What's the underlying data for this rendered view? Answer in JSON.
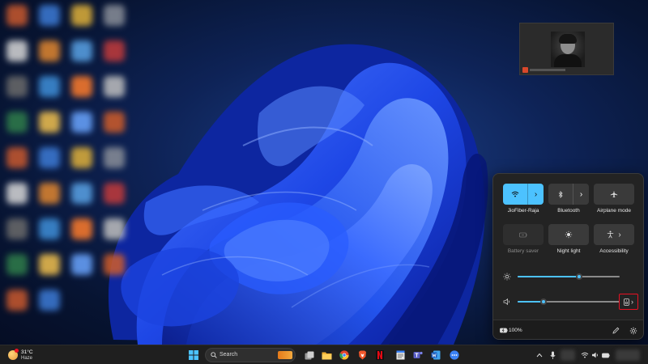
{
  "desktop": {
    "icon_colors": [
      "#c9592e",
      "#3d7bd6",
      "#e0b13a",
      "#8a8f99",
      "#d8d8d8",
      "#e2872f",
      "#5aa3e6",
      "#c43b3b",
      "#6b6b6b",
      "#3f8fd9",
      "#ff7c2b",
      "#c0c0c0",
      "#2f7d4a",
      "#f2c14e",
      "#6aa5ff",
      "#d15d2a"
    ]
  },
  "camera_preview": {
    "accent": "#d9482b"
  },
  "quick_settings": {
    "tiles": [
      {
        "label": "JioFiber-Raja",
        "icon": "wifi-icon",
        "state": "on",
        "split": true
      },
      {
        "label": "Bluetooth",
        "icon": "bluetooth-icon",
        "state": "off",
        "split": true
      },
      {
        "label": "Airplane mode",
        "icon": "airplane-icon",
        "state": "off",
        "split": false
      },
      {
        "label": "Battery saver",
        "icon": "battery-saver-icon",
        "state": "disabled",
        "split": false
      },
      {
        "label": "Night light",
        "icon": "night-light-icon",
        "state": "off",
        "split": false
      },
      {
        "label": "Accessibility",
        "icon": "accessibility-icon",
        "state": "off",
        "split": true
      }
    ],
    "brightness": {
      "icon": "brightness-icon",
      "level": 0.6
    },
    "volume": {
      "icon": "speaker-icon",
      "level": 0.25
    },
    "audio_output": {
      "icon": "audio-output-icon",
      "highlighted": true,
      "highlight_color": "#e81123"
    },
    "battery": {
      "icon": "battery-icon",
      "text": "100%"
    },
    "edit_icon": "pencil-icon",
    "settings_icon": "gear-icon",
    "accent": "#4cc2ff"
  },
  "taskbar": {
    "weather": {
      "temp": "31°C",
      "condition": "Haze"
    },
    "search": {
      "label": "Search"
    },
    "apps": [
      {
        "name": "start-button",
        "color": "#4cc2ff"
      },
      {
        "name": "task-view-icon",
        "color": "#cfcfcf"
      },
      {
        "name": "file-explorer-icon",
        "color": "#f2b134"
      },
      {
        "name": "chrome-icon",
        "color": "#e2452c"
      },
      {
        "name": "brave-icon",
        "color": "#f1562b"
      },
      {
        "name": "netflix-icon",
        "color": "#e50914"
      },
      {
        "name": "notepad-icon",
        "color": "#e8e8e8"
      },
      {
        "name": "teams-icon",
        "color": "#5b5fc7"
      },
      {
        "name": "word-icon",
        "color": "#2b7cd3"
      },
      {
        "name": "meeting-icon",
        "color": "#3b82f6"
      }
    ],
    "tray_icons": [
      "chevron-up-icon",
      "microphone-icon",
      "wifi-icon",
      "speaker-icon",
      "battery-icon"
    ]
  }
}
